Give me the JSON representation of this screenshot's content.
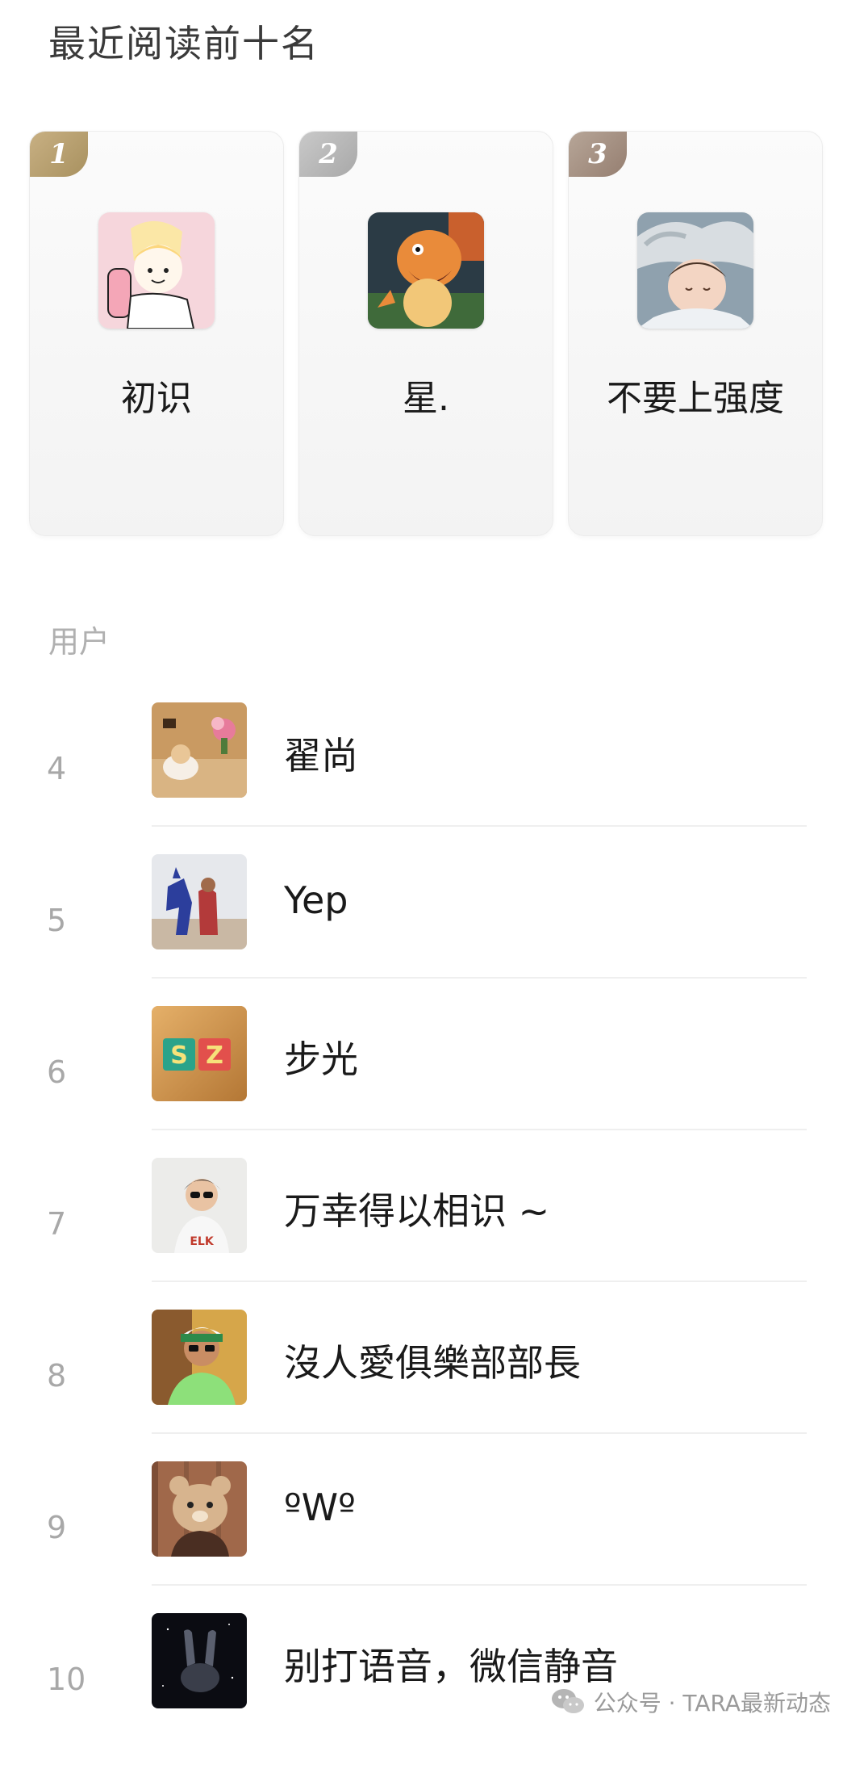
{
  "header": {
    "title": "最近阅读前十名"
  },
  "podium": [
    {
      "rank": "1",
      "name": "初识"
    },
    {
      "rank": "2",
      "name": "星."
    },
    {
      "rank": "3",
      "name": "不要上强度"
    }
  ],
  "users_section": {
    "label": "用户"
  },
  "users": [
    {
      "rank": "4",
      "name": "翟尚"
    },
    {
      "rank": "5",
      "name": "Yep"
    },
    {
      "rank": "6",
      "name": "步光"
    },
    {
      "rank": "7",
      "name": "万幸得以相识 ~"
    },
    {
      "rank": "8",
      "name": "沒人愛俱樂部部長"
    },
    {
      "rank": "9",
      "name": "ºWº"
    },
    {
      "rank": "10",
      "name": "别打语音，微信静音"
    }
  ],
  "watermark": {
    "text": "公众号 · TARA最新动态"
  }
}
